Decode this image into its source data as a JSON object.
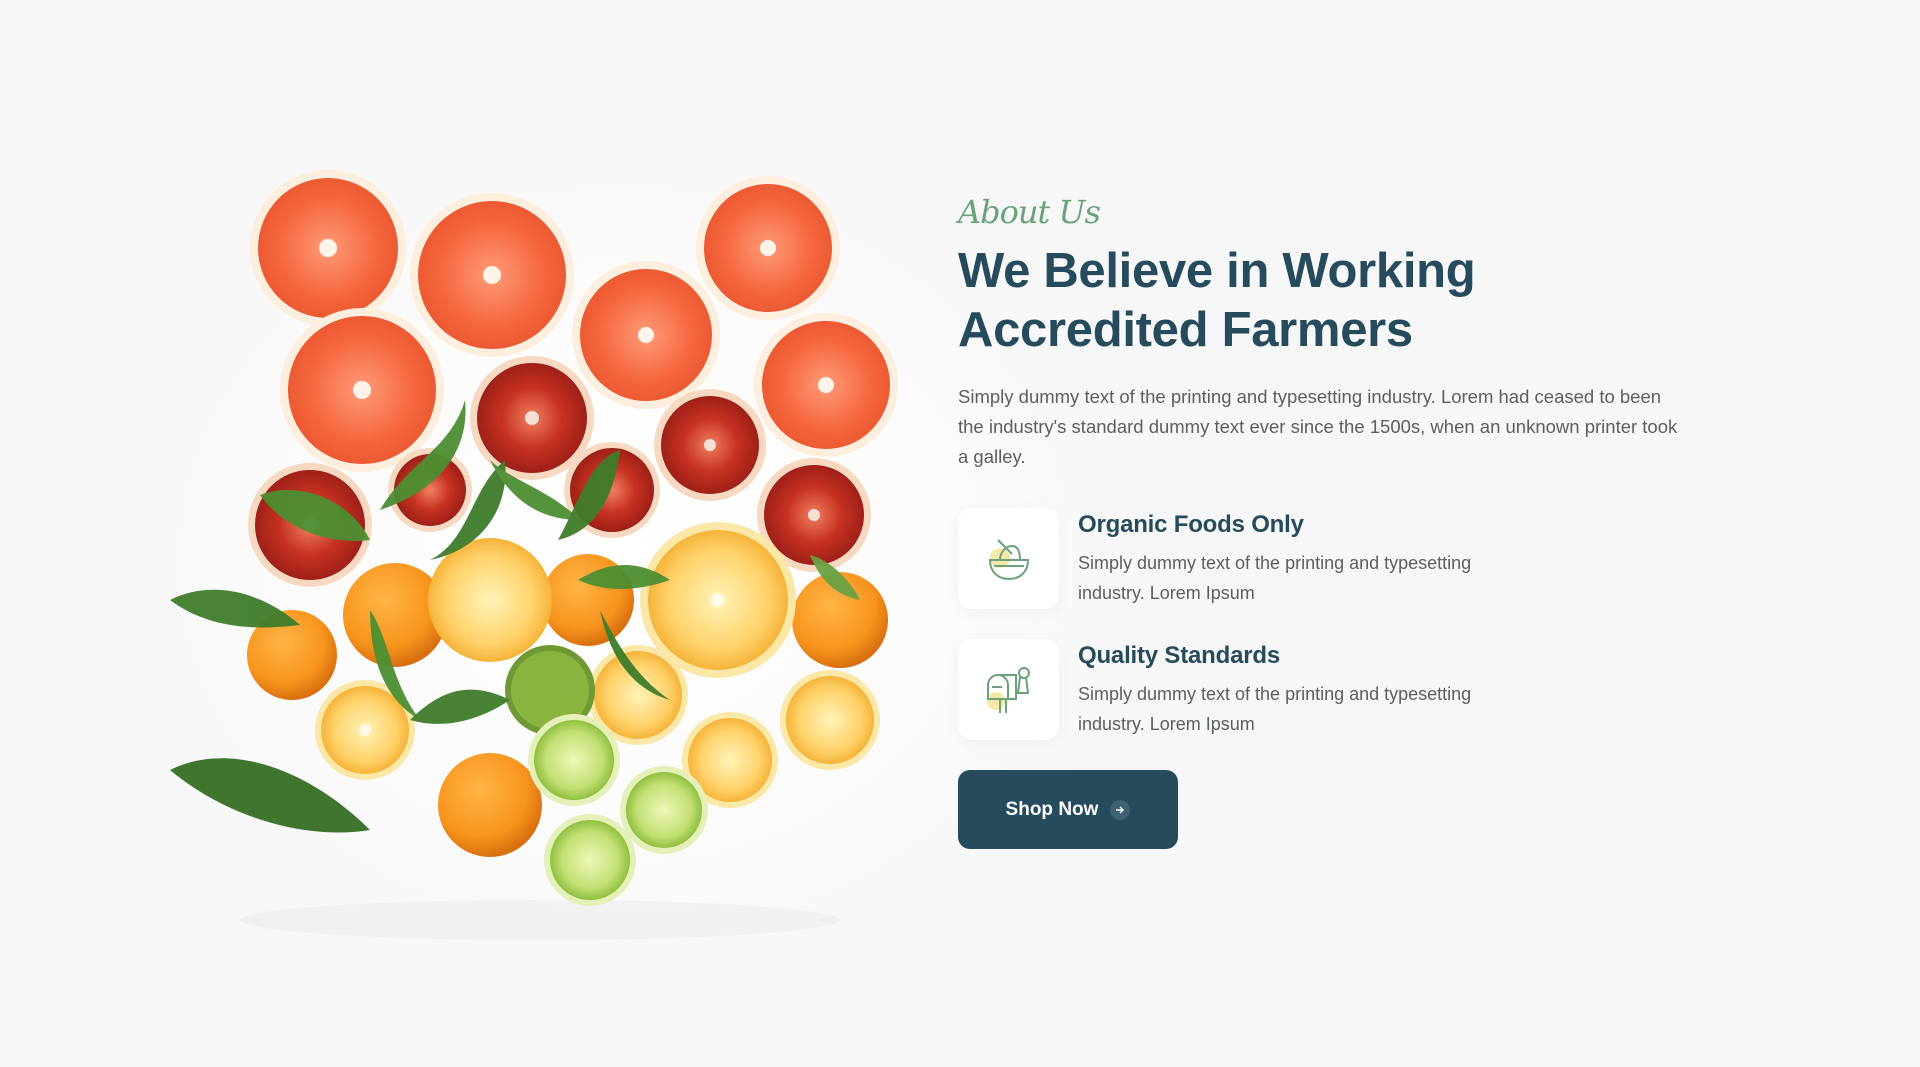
{
  "about": {
    "eyebrow": "About Us",
    "title_line1": "We Believe in Working",
    "title_line2": "Accredited Farmers",
    "description": "Simply dummy text of the printing and typesetting industry. Lorem had ceased to been the industry's standard dummy text ever since the 1500s, when an unknown printer took a galley."
  },
  "features": [
    {
      "icon": "organic-bowl-icon",
      "title": "Organic Foods Only",
      "description": "Simply dummy text of the printing and typesetting industry. Lorem Ipsum"
    },
    {
      "icon": "quality-mailbox-icon",
      "title": "Quality Standards",
      "description": "Simply dummy text of the printing and typesetting industry. Lorem Ipsum"
    }
  ],
  "cta": {
    "label": "Shop Now",
    "icon": "arrow-right-icon"
  },
  "colors": {
    "primary": "#264b5d",
    "accent": "#6aa37a",
    "highlight": "#f5e9a8",
    "background": "#f7f7f7"
  }
}
